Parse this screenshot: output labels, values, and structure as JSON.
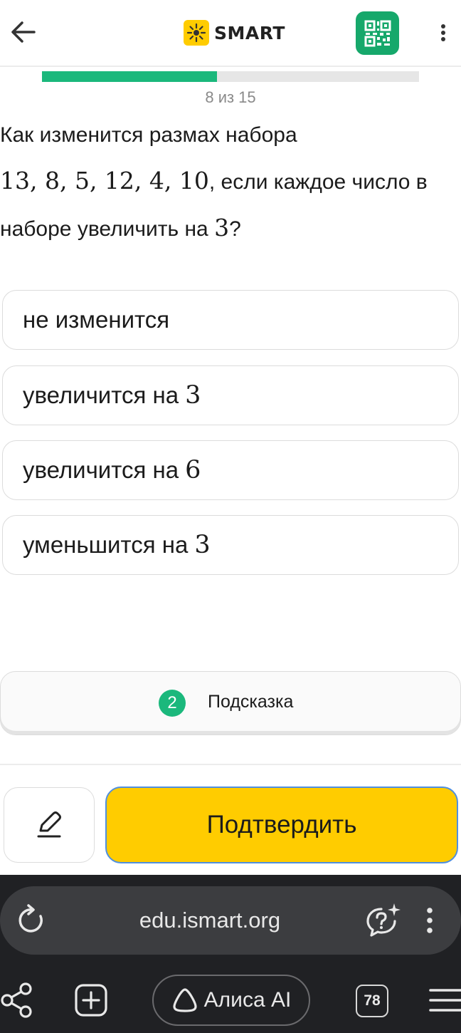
{
  "header": {
    "brand": "SMART",
    "icons": {
      "back": "arrow-left-icon",
      "logo": "sun-icon",
      "qr": "qr-code-icon",
      "more": "more-vertical-icon"
    },
    "colors": {
      "logo_bg": "#ffcc00",
      "qr_bg": "#16a86b"
    }
  },
  "progress": {
    "text": "8 из 15",
    "fraction": 0.465,
    "color": "#1bb87c"
  },
  "question": {
    "part1": "Как изменится размах набора",
    "numbers": "13,  8,  5,  12,  4,  10",
    "part2": ", если каждое число в наборе увеличить на ",
    "part2_num": "3",
    "part3": "?"
  },
  "options": [
    {
      "text": "не изменится",
      "num": ""
    },
    {
      "text": "увеличится на",
      "num": "3"
    },
    {
      "text": "увеличится на",
      "num": "6"
    },
    {
      "text": "уменьшится на",
      "num": "3"
    }
  ],
  "hint": {
    "count": "2",
    "label": "Подсказка",
    "color": "#1bb87c"
  },
  "footer": {
    "confirm_label": "Подтвердить",
    "confirm_color": "#ffcc00",
    "edit_icon": "pencil-icon"
  },
  "browser": {
    "url": "edu.ismart.org",
    "alice_label": "Алиса AI",
    "tabs_count": "78",
    "icons": {
      "reload": "reload-icon",
      "assistant": "chat-question-icon",
      "url_more": "more-vertical-icon",
      "share": "share-icon",
      "new_tab": "new-tab-icon",
      "alice": "alice-icon",
      "menu": "hamburger-menu-icon"
    }
  }
}
